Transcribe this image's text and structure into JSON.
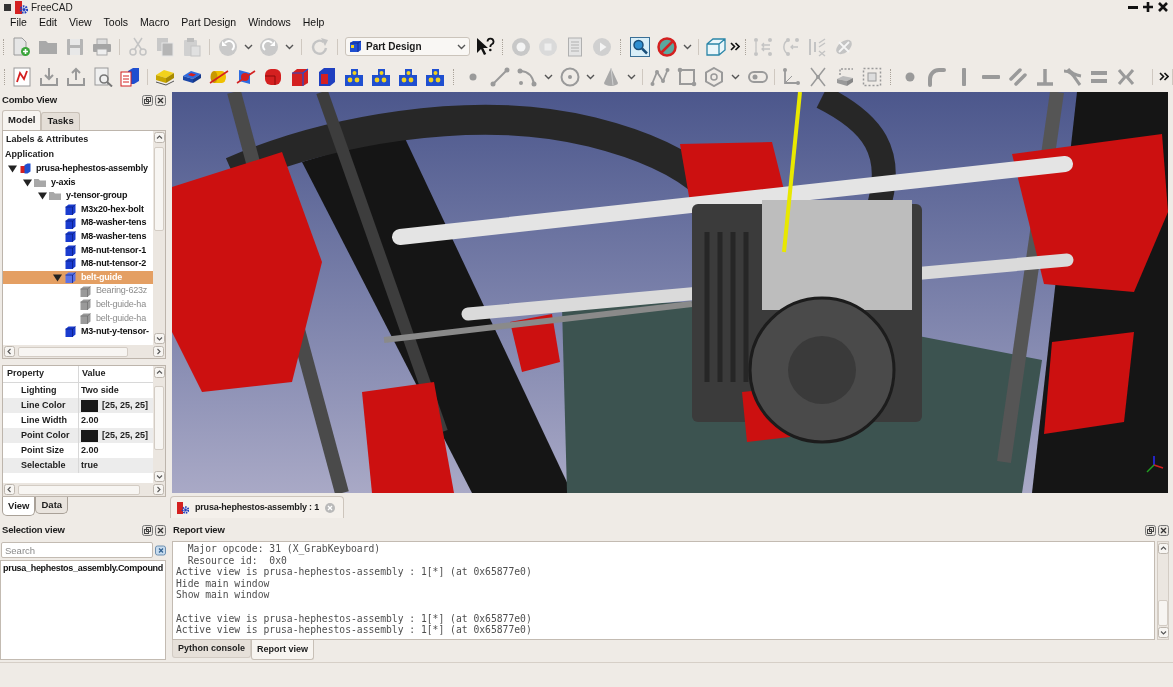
{
  "window": {
    "title": "FreeCAD"
  },
  "menu": [
    "File",
    "Edit",
    "View",
    "Tools",
    "Macro",
    "Part Design",
    "Windows",
    "Help"
  ],
  "toolbar": {
    "workbench": "Part Design"
  },
  "combo_view": {
    "title": "Combo View",
    "tabs": [
      {
        "label": "Model",
        "selected": true
      },
      {
        "label": "Tasks",
        "selected": false
      }
    ],
    "tree": {
      "header": "Labels & Attributes",
      "root": "Application",
      "items": [
        {
          "label": "prusa-hephestos-assembly",
          "kind": "assembly",
          "expanded": true,
          "selected": false,
          "hidden": false,
          "children": [
            {
              "label": "y-axis",
              "kind": "group",
              "expanded": true,
              "selected": false,
              "hidden": false,
              "children": [
                {
                  "label": "y-tensor-group",
                  "kind": "group",
                  "expanded": true,
                  "selected": false,
                  "hidden": false,
                  "children": [
                    {
                      "label": "M3x20-hex-bolt",
                      "kind": "part",
                      "selected": false,
                      "hidden": false
                    },
                    {
                      "label": "M8-washer-tens",
                      "kind": "part",
                      "selected": false,
                      "hidden": false
                    },
                    {
                      "label": "M8-washer-tens",
                      "kind": "part",
                      "selected": false,
                      "hidden": false
                    },
                    {
                      "label": "M8-nut-tensor-1",
                      "kind": "part",
                      "selected": false,
                      "hidden": false
                    },
                    {
                      "label": "M8-nut-tensor-2",
                      "kind": "part",
                      "selected": false,
                      "hidden": false
                    },
                    {
                      "label": "belt-guide",
                      "kind": "part",
                      "expanded": true,
                      "selected": true,
                      "hidden": false,
                      "children": [
                        {
                          "label": "Bearing-623z",
                          "kind": "part",
                          "selected": false,
                          "hidden": true
                        },
                        {
                          "label": "belt-guide-ha",
                          "kind": "part",
                          "selected": false,
                          "hidden": true
                        },
                        {
                          "label": "belt-guide-ha",
                          "kind": "part",
                          "selected": false,
                          "hidden": true
                        }
                      ]
                    },
                    {
                      "label": "M3-nut-y-tensor-",
                      "kind": "part",
                      "selected": false,
                      "hidden": false
                    }
                  ]
                }
              ]
            }
          ]
        }
      ]
    },
    "properties": {
      "columns": [
        "Property",
        "Value"
      ],
      "rows": [
        {
          "name": "Lighting",
          "value": "Two side"
        },
        {
          "name": "Line Color",
          "value": "[25, 25, 25]",
          "color": "#191919"
        },
        {
          "name": "Line Width",
          "value": "2.00"
        },
        {
          "name": "Point Color",
          "value": "[25, 25, 25]",
          "color": "#191919"
        },
        {
          "name": "Point Size",
          "value": "2.00"
        },
        {
          "name": "Selectable",
          "value": "true"
        }
      ]
    },
    "property_tabs": [
      {
        "label": "View",
        "selected": true
      },
      {
        "label": "Data",
        "selected": false
      }
    ]
  },
  "document_tabs": [
    {
      "label": "prusa-hephestos-assembly : 1",
      "selected": true
    }
  ],
  "selection_view": {
    "title": "Selection view",
    "search": {
      "placeholder": "Search"
    },
    "items": [
      {
        "label": "prusa_hephestos_assembly.Compound",
        "selected": false
      }
    ]
  },
  "report_view": {
    "title": "Report view",
    "blocks": [
      [
        "  Major opcode: 31 (X_GrabKeyboard)",
        "  Resource id:  0x0",
        "Active view is prusa-hephestos-assembly : 1[*] (at 0x65877e0)",
        "Hide main window",
        "Show main window"
      ],
      [
        "Active view is prusa-hephestos-assembly : 1[*] (at 0x65877e0)",
        "Active view is prusa-hephestos-assembly : 1[*] (at 0x65877e0)"
      ]
    ],
    "tabs": [
      {
        "label": "Python console",
        "selected": false
      },
      {
        "label": "Report view",
        "selected": true
      }
    ]
  }
}
